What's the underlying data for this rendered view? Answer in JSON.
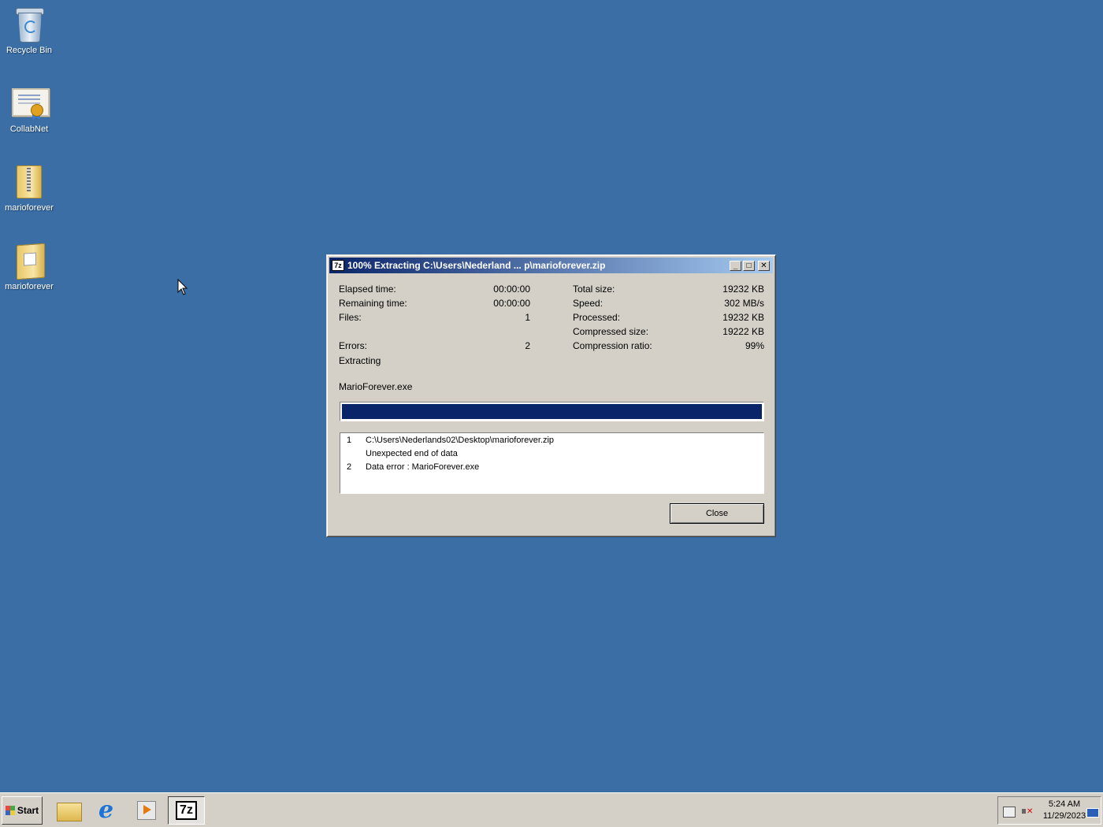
{
  "desktop": {
    "background_color": "#3a6ea5",
    "icons": [
      {
        "label": "Recycle Bin",
        "icon": "recycle-bin-icon"
      },
      {
        "label": "CollabNet",
        "icon": "certificate-icon"
      },
      {
        "label": "marioforever",
        "icon": "zip-folder-icon"
      },
      {
        "label": "marioforever",
        "icon": "zip-folder-icon"
      }
    ]
  },
  "dialog": {
    "title_icon": "7z",
    "title": "100% Extracting C:\\Users\\Nederland ... p\\marioforever.zip",
    "title_buttons": {
      "minimize": "_",
      "maximize": "□",
      "close": "✕"
    },
    "left_stats": {
      "elapsed_label": "Elapsed time:",
      "elapsed_value": "00:00:00",
      "remaining_label": "Remaining time:",
      "remaining_value": "00:00:00",
      "files_label": "Files:",
      "files_value": "1",
      "errors_label": "Errors:",
      "errors_value": "2"
    },
    "right_stats": {
      "total_size_label": "Total size:",
      "total_size_value": "19232 KB",
      "speed_label": "Speed:",
      "speed_value": "302 MB/s",
      "processed_label": "Processed:",
      "processed_value": "19232 KB",
      "compressed_size_label": "Compressed size:",
      "compressed_size_value": "19222 KB",
      "ratio_label": "Compression ratio:",
      "ratio_value": "99%"
    },
    "status": "Extracting",
    "current_file": "MarioForever.exe",
    "progress_percent": 100,
    "errors": [
      {
        "num": "1",
        "text": "C:\\Users\\Nederlands02\\Desktop\\marioforever.zip"
      },
      {
        "num": "",
        "text": "Unexpected end of data"
      },
      {
        "num": "2",
        "text": "Data error : MarioForever.exe"
      }
    ],
    "close_button": "Close"
  },
  "taskbar": {
    "start_label": "Start",
    "task_7z_label": "7z",
    "clock_time": "5:24 AM",
    "clock_date": "11/29/2023"
  }
}
